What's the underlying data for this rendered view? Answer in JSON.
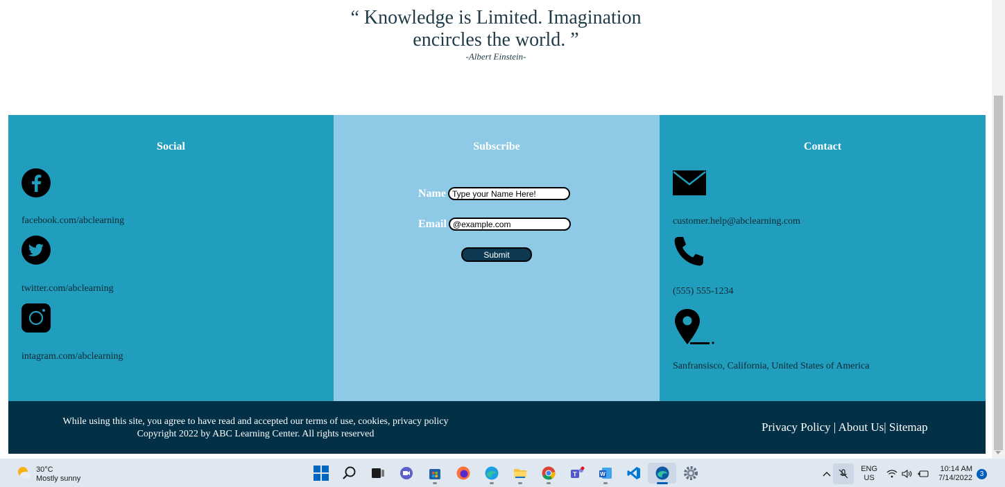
{
  "quote": {
    "text": "“ Knowledge is Limited. Imagination encircles the world. ”",
    "author": "-Albert Einstein-"
  },
  "social": {
    "title": "Social",
    "items": [
      {
        "icon": "facebook-icon",
        "text": "facebook.com/abclearning"
      },
      {
        "icon": "twitter-icon",
        "text": "twitter.com/abclearning"
      },
      {
        "icon": "instagram-icon",
        "text": "intagram.com/abclearning"
      }
    ]
  },
  "subscribe": {
    "title": "Subscribe",
    "name_label": "Name",
    "name_value": "Type your Name Here!",
    "email_label": "Email",
    "email_value": "@example.com",
    "submit_label": "Submit"
  },
  "contact": {
    "title": "Contact",
    "items": [
      {
        "icon": "mail-icon",
        "text": "customer.help@abclearning.com"
      },
      {
        "icon": "phone-icon",
        "text": "(555) 555-1234"
      },
      {
        "icon": "location-pin-icon",
        "text": "Sanfransisco, California, United States of America"
      }
    ]
  },
  "footer": {
    "legal_line1": "While using this site, you agree to have read and accepted our terms of use, cookies, privacy policy",
    "legal_line2": "Copyright 2022 by ABC Learning Center. All rights reserved",
    "links": [
      {
        "label": "Privacy Policy"
      },
      {
        "label": "About Us"
      },
      {
        "label": "Sitemap"
      }
    ],
    "separator": "|"
  },
  "taskbar": {
    "weather_temp": "30°C",
    "weather_desc": "Mostly sunny",
    "apps": [
      {
        "icon": "windows-start-icon",
        "active": false
      },
      {
        "icon": "search-icon",
        "active": false
      },
      {
        "icon": "task-view-icon",
        "active": false
      },
      {
        "icon": "chat-icon",
        "active": false
      },
      {
        "icon": "store-icon",
        "active": false
      },
      {
        "icon": "firefox-icon",
        "active": false
      },
      {
        "icon": "edge-icon",
        "active": false
      },
      {
        "icon": "file-explorer-icon",
        "active": false
      },
      {
        "icon": "chrome-icon",
        "active": false
      },
      {
        "icon": "teams-icon",
        "active": false
      },
      {
        "icon": "word-icon",
        "active": false
      },
      {
        "icon": "vscode-icon",
        "active": false
      },
      {
        "icon": "edge-dev-icon",
        "active": true
      },
      {
        "icon": "settings-icon",
        "active": false
      }
    ],
    "lang_top": "ENG",
    "lang_bottom": "US",
    "time": "10:14 AM",
    "date": "7/14/2022",
    "notification_count": "3"
  },
  "colors": {
    "social_bg": "#219dbd",
    "subscribe_bg": "#8ecae6",
    "contact_bg": "#219dbd",
    "bottom_bar_bg": "#023047",
    "button_bg": "#0d3a52"
  }
}
